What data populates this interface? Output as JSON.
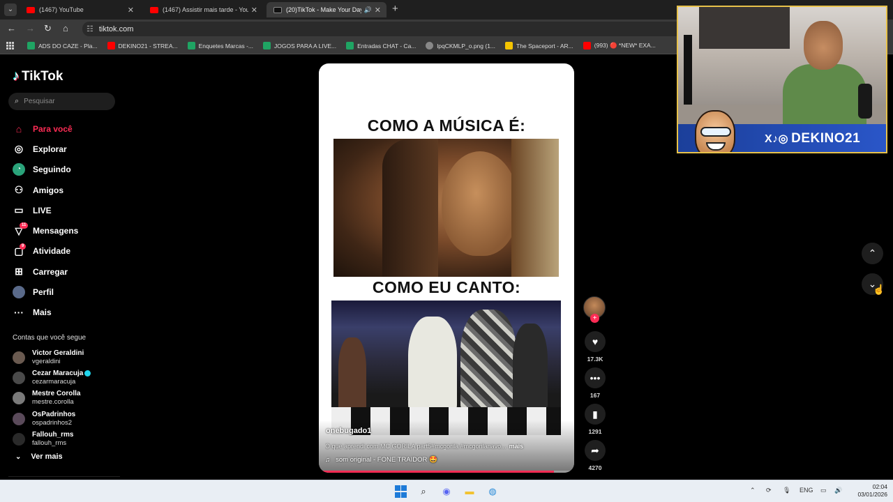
{
  "browser": {
    "tabs": [
      {
        "title": "(1467) YouTube",
        "favicon_color": "#ff0000",
        "active": false
      },
      {
        "title": "(1467) Assistir mais tarde - YouT",
        "favicon_color": "#ff0000",
        "active": false
      },
      {
        "title": "(20)TikTok - Make Your Day",
        "favicon_color": "#111111",
        "active": true
      }
    ],
    "url": "tiktok.com",
    "bookmarks": [
      {
        "label": "ADS DO CAZE - Pla...",
        "color": "#1fa463"
      },
      {
        "label": "DEKINO21 - STREA...",
        "color": "#ff0000"
      },
      {
        "label": "Enquetes Marcas -...",
        "color": "#1fa463"
      },
      {
        "label": "JOGOS PARA A LIVE...",
        "color": "#1fa463"
      },
      {
        "label": "Entradas CHAT - Ca...",
        "color": "#1fa463"
      },
      {
        "label": "lpqCKMLP_o.png (1...",
        "color": "#888888"
      },
      {
        "label": "The Spaceport - AR...",
        "color": "#f5c400"
      },
      {
        "label": "(993) 🔴 *NEW* EXA...",
        "color": "#ff0000"
      }
    ]
  },
  "sidebar": {
    "logo": "TikTok",
    "search_placeholder": "Pesquisar",
    "nav": [
      {
        "label": "Para você",
        "icon": "home-icon",
        "active": true
      },
      {
        "label": "Explorar",
        "icon": "compass-icon"
      },
      {
        "label": "Seguindo",
        "icon": "following-icon"
      },
      {
        "label": "Amigos",
        "icon": "friends-icon"
      },
      {
        "label": "LIVE",
        "icon": "live-icon"
      },
      {
        "label": "Mensagens",
        "icon": "messages-icon",
        "badge": "11"
      },
      {
        "label": "Atividade",
        "icon": "activity-icon",
        "badge": "9"
      },
      {
        "label": "Carregar",
        "icon": "upload-icon"
      },
      {
        "label": "Perfil",
        "icon": "profile-icon"
      },
      {
        "label": "Mais",
        "icon": "more-icon"
      }
    ],
    "following_title": "Contas que você segue",
    "following": [
      {
        "name": "Victor Geraldini",
        "handle": "vgeraldini",
        "verified": false
      },
      {
        "name": "Cezar Maracuja",
        "handle": "cezarmaracuja",
        "verified": true
      },
      {
        "name": "Mestre Corolla",
        "handle": "mestre.corolla",
        "verified": false
      },
      {
        "name": "OsPadrinhos",
        "handle": "ospadrinhos2",
        "verified": false
      },
      {
        "name": "Fallouh_rms",
        "handle": "fallouh_rms",
        "verified": false
      }
    ],
    "see_more": "Ver mais"
  },
  "video": {
    "caption_top": "COMO A MÚSICA É:",
    "caption_middle": "COMO EU CANTO:",
    "author": "onebugado1",
    "description": "O que aprendi com MC GORILA part5#mcgorila #mcgorilanavo...",
    "more": "mais",
    "music": "som original - FONE TRAIDOR 🤩",
    "progress": 0.92
  },
  "actions": {
    "likes": "17.3K",
    "comments": "167",
    "saves": "1291",
    "shares": "4270"
  },
  "webcam": {
    "banner_text": "DEKINO21",
    "banner_icons": "X♪◎"
  },
  "taskbar": {
    "lang": "ENG",
    "time": "02:04",
    "date": "03/01/2026"
  }
}
